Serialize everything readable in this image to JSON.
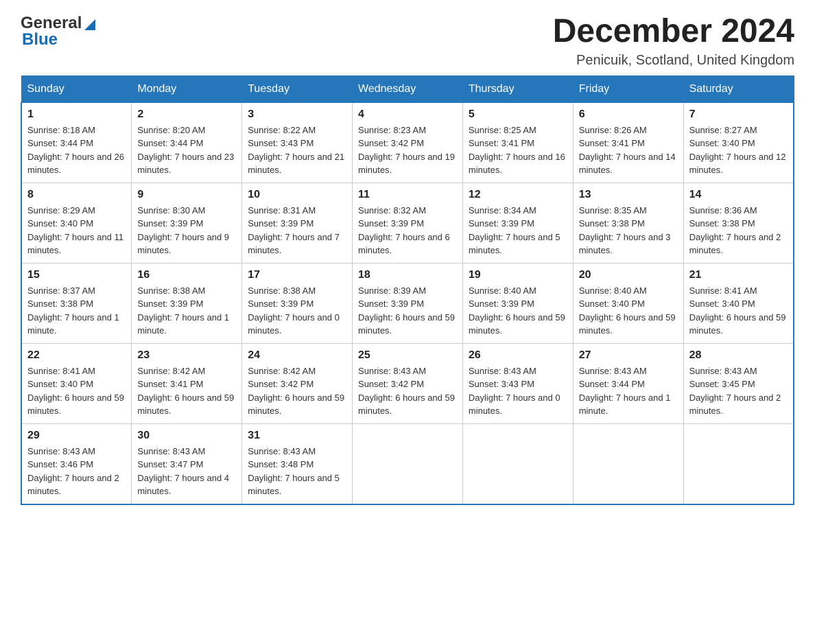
{
  "header": {
    "logo": {
      "general": "General",
      "blue": "Blue",
      "arrow": "▶"
    },
    "title": "December 2024",
    "subtitle": "Penicuik, Scotland, United Kingdom"
  },
  "calendar": {
    "days_of_week": [
      "Sunday",
      "Monday",
      "Tuesday",
      "Wednesday",
      "Thursday",
      "Friday",
      "Saturday"
    ],
    "weeks": [
      [
        {
          "day": "1",
          "sunrise": "8:18 AM",
          "sunset": "3:44 PM",
          "daylight": "7 hours and 26 minutes."
        },
        {
          "day": "2",
          "sunrise": "8:20 AM",
          "sunset": "3:44 PM",
          "daylight": "7 hours and 23 minutes."
        },
        {
          "day": "3",
          "sunrise": "8:22 AM",
          "sunset": "3:43 PM",
          "daylight": "7 hours and 21 minutes."
        },
        {
          "day": "4",
          "sunrise": "8:23 AM",
          "sunset": "3:42 PM",
          "daylight": "7 hours and 19 minutes."
        },
        {
          "day": "5",
          "sunrise": "8:25 AM",
          "sunset": "3:41 PM",
          "daylight": "7 hours and 16 minutes."
        },
        {
          "day": "6",
          "sunrise": "8:26 AM",
          "sunset": "3:41 PM",
          "daylight": "7 hours and 14 minutes."
        },
        {
          "day": "7",
          "sunrise": "8:27 AM",
          "sunset": "3:40 PM",
          "daylight": "7 hours and 12 minutes."
        }
      ],
      [
        {
          "day": "8",
          "sunrise": "8:29 AM",
          "sunset": "3:40 PM",
          "daylight": "7 hours and 11 minutes."
        },
        {
          "day": "9",
          "sunrise": "8:30 AM",
          "sunset": "3:39 PM",
          "daylight": "7 hours and 9 minutes."
        },
        {
          "day": "10",
          "sunrise": "8:31 AM",
          "sunset": "3:39 PM",
          "daylight": "7 hours and 7 minutes."
        },
        {
          "day": "11",
          "sunrise": "8:32 AM",
          "sunset": "3:39 PM",
          "daylight": "7 hours and 6 minutes."
        },
        {
          "day": "12",
          "sunrise": "8:34 AM",
          "sunset": "3:39 PM",
          "daylight": "7 hours and 5 minutes."
        },
        {
          "day": "13",
          "sunrise": "8:35 AM",
          "sunset": "3:38 PM",
          "daylight": "7 hours and 3 minutes."
        },
        {
          "day": "14",
          "sunrise": "8:36 AM",
          "sunset": "3:38 PM",
          "daylight": "7 hours and 2 minutes."
        }
      ],
      [
        {
          "day": "15",
          "sunrise": "8:37 AM",
          "sunset": "3:38 PM",
          "daylight": "7 hours and 1 minute."
        },
        {
          "day": "16",
          "sunrise": "8:38 AM",
          "sunset": "3:39 PM",
          "daylight": "7 hours and 1 minute."
        },
        {
          "day": "17",
          "sunrise": "8:38 AM",
          "sunset": "3:39 PM",
          "daylight": "7 hours and 0 minutes."
        },
        {
          "day": "18",
          "sunrise": "8:39 AM",
          "sunset": "3:39 PM",
          "daylight": "6 hours and 59 minutes."
        },
        {
          "day": "19",
          "sunrise": "8:40 AM",
          "sunset": "3:39 PM",
          "daylight": "6 hours and 59 minutes."
        },
        {
          "day": "20",
          "sunrise": "8:40 AM",
          "sunset": "3:40 PM",
          "daylight": "6 hours and 59 minutes."
        },
        {
          "day": "21",
          "sunrise": "8:41 AM",
          "sunset": "3:40 PM",
          "daylight": "6 hours and 59 minutes."
        }
      ],
      [
        {
          "day": "22",
          "sunrise": "8:41 AM",
          "sunset": "3:40 PM",
          "daylight": "6 hours and 59 minutes."
        },
        {
          "day": "23",
          "sunrise": "8:42 AM",
          "sunset": "3:41 PM",
          "daylight": "6 hours and 59 minutes."
        },
        {
          "day": "24",
          "sunrise": "8:42 AM",
          "sunset": "3:42 PM",
          "daylight": "6 hours and 59 minutes."
        },
        {
          "day": "25",
          "sunrise": "8:43 AM",
          "sunset": "3:42 PM",
          "daylight": "6 hours and 59 minutes."
        },
        {
          "day": "26",
          "sunrise": "8:43 AM",
          "sunset": "3:43 PM",
          "daylight": "7 hours and 0 minutes."
        },
        {
          "day": "27",
          "sunrise": "8:43 AM",
          "sunset": "3:44 PM",
          "daylight": "7 hours and 1 minute."
        },
        {
          "day": "28",
          "sunrise": "8:43 AM",
          "sunset": "3:45 PM",
          "daylight": "7 hours and 2 minutes."
        }
      ],
      [
        {
          "day": "29",
          "sunrise": "8:43 AM",
          "sunset": "3:46 PM",
          "daylight": "7 hours and 2 minutes."
        },
        {
          "day": "30",
          "sunrise": "8:43 AM",
          "sunset": "3:47 PM",
          "daylight": "7 hours and 4 minutes."
        },
        {
          "day": "31",
          "sunrise": "8:43 AM",
          "sunset": "3:48 PM",
          "daylight": "7 hours and 5 minutes."
        },
        null,
        null,
        null,
        null
      ]
    ],
    "sunrise_label": "Sunrise:",
    "sunset_label": "Sunset:",
    "daylight_label": "Daylight:"
  }
}
